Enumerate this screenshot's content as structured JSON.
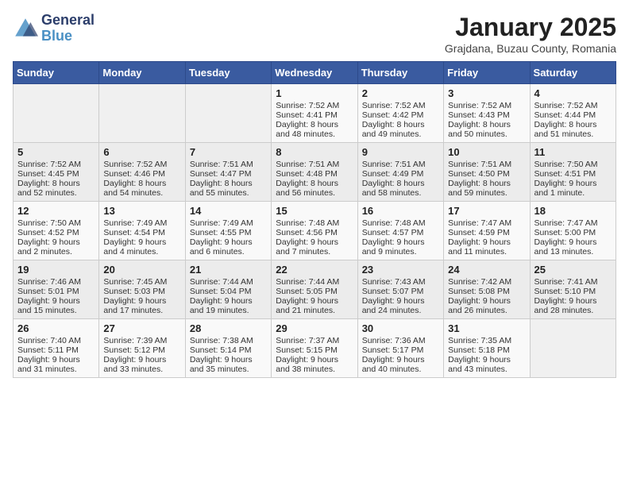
{
  "header": {
    "logo_line1": "General",
    "logo_line2": "Blue",
    "month": "January 2025",
    "location": "Grajdana, Buzau County, Romania"
  },
  "days_of_week": [
    "Sunday",
    "Monday",
    "Tuesday",
    "Wednesday",
    "Thursday",
    "Friday",
    "Saturday"
  ],
  "weeks": [
    [
      {
        "day": "",
        "content": ""
      },
      {
        "day": "",
        "content": ""
      },
      {
        "day": "",
        "content": ""
      },
      {
        "day": "1",
        "content": "Sunrise: 7:52 AM\nSunset: 4:41 PM\nDaylight: 8 hours and 48 minutes."
      },
      {
        "day": "2",
        "content": "Sunrise: 7:52 AM\nSunset: 4:42 PM\nDaylight: 8 hours and 49 minutes."
      },
      {
        "day": "3",
        "content": "Sunrise: 7:52 AM\nSunset: 4:43 PM\nDaylight: 8 hours and 50 minutes."
      },
      {
        "day": "4",
        "content": "Sunrise: 7:52 AM\nSunset: 4:44 PM\nDaylight: 8 hours and 51 minutes."
      }
    ],
    [
      {
        "day": "5",
        "content": "Sunrise: 7:52 AM\nSunset: 4:45 PM\nDaylight: 8 hours and 52 minutes."
      },
      {
        "day": "6",
        "content": "Sunrise: 7:52 AM\nSunset: 4:46 PM\nDaylight: 8 hours and 54 minutes."
      },
      {
        "day": "7",
        "content": "Sunrise: 7:51 AM\nSunset: 4:47 PM\nDaylight: 8 hours and 55 minutes."
      },
      {
        "day": "8",
        "content": "Sunrise: 7:51 AM\nSunset: 4:48 PM\nDaylight: 8 hours and 56 minutes."
      },
      {
        "day": "9",
        "content": "Sunrise: 7:51 AM\nSunset: 4:49 PM\nDaylight: 8 hours and 58 minutes."
      },
      {
        "day": "10",
        "content": "Sunrise: 7:51 AM\nSunset: 4:50 PM\nDaylight: 8 hours and 59 minutes."
      },
      {
        "day": "11",
        "content": "Sunrise: 7:50 AM\nSunset: 4:51 PM\nDaylight: 9 hours and 1 minute."
      }
    ],
    [
      {
        "day": "12",
        "content": "Sunrise: 7:50 AM\nSunset: 4:52 PM\nDaylight: 9 hours and 2 minutes."
      },
      {
        "day": "13",
        "content": "Sunrise: 7:49 AM\nSunset: 4:54 PM\nDaylight: 9 hours and 4 minutes."
      },
      {
        "day": "14",
        "content": "Sunrise: 7:49 AM\nSunset: 4:55 PM\nDaylight: 9 hours and 6 minutes."
      },
      {
        "day": "15",
        "content": "Sunrise: 7:48 AM\nSunset: 4:56 PM\nDaylight: 9 hours and 7 minutes."
      },
      {
        "day": "16",
        "content": "Sunrise: 7:48 AM\nSunset: 4:57 PM\nDaylight: 9 hours and 9 minutes."
      },
      {
        "day": "17",
        "content": "Sunrise: 7:47 AM\nSunset: 4:59 PM\nDaylight: 9 hours and 11 minutes."
      },
      {
        "day": "18",
        "content": "Sunrise: 7:47 AM\nSunset: 5:00 PM\nDaylight: 9 hours and 13 minutes."
      }
    ],
    [
      {
        "day": "19",
        "content": "Sunrise: 7:46 AM\nSunset: 5:01 PM\nDaylight: 9 hours and 15 minutes."
      },
      {
        "day": "20",
        "content": "Sunrise: 7:45 AM\nSunset: 5:03 PM\nDaylight: 9 hours and 17 minutes."
      },
      {
        "day": "21",
        "content": "Sunrise: 7:44 AM\nSunset: 5:04 PM\nDaylight: 9 hours and 19 minutes."
      },
      {
        "day": "22",
        "content": "Sunrise: 7:44 AM\nSunset: 5:05 PM\nDaylight: 9 hours and 21 minutes."
      },
      {
        "day": "23",
        "content": "Sunrise: 7:43 AM\nSunset: 5:07 PM\nDaylight: 9 hours and 24 minutes."
      },
      {
        "day": "24",
        "content": "Sunrise: 7:42 AM\nSunset: 5:08 PM\nDaylight: 9 hours and 26 minutes."
      },
      {
        "day": "25",
        "content": "Sunrise: 7:41 AM\nSunset: 5:10 PM\nDaylight: 9 hours and 28 minutes."
      }
    ],
    [
      {
        "day": "26",
        "content": "Sunrise: 7:40 AM\nSunset: 5:11 PM\nDaylight: 9 hours and 31 minutes."
      },
      {
        "day": "27",
        "content": "Sunrise: 7:39 AM\nSunset: 5:12 PM\nDaylight: 9 hours and 33 minutes."
      },
      {
        "day": "28",
        "content": "Sunrise: 7:38 AM\nSunset: 5:14 PM\nDaylight: 9 hours and 35 minutes."
      },
      {
        "day": "29",
        "content": "Sunrise: 7:37 AM\nSunset: 5:15 PM\nDaylight: 9 hours and 38 minutes."
      },
      {
        "day": "30",
        "content": "Sunrise: 7:36 AM\nSunset: 5:17 PM\nDaylight: 9 hours and 40 minutes."
      },
      {
        "day": "31",
        "content": "Sunrise: 7:35 AM\nSunset: 5:18 PM\nDaylight: 9 hours and 43 minutes."
      },
      {
        "day": "",
        "content": ""
      }
    ]
  ]
}
